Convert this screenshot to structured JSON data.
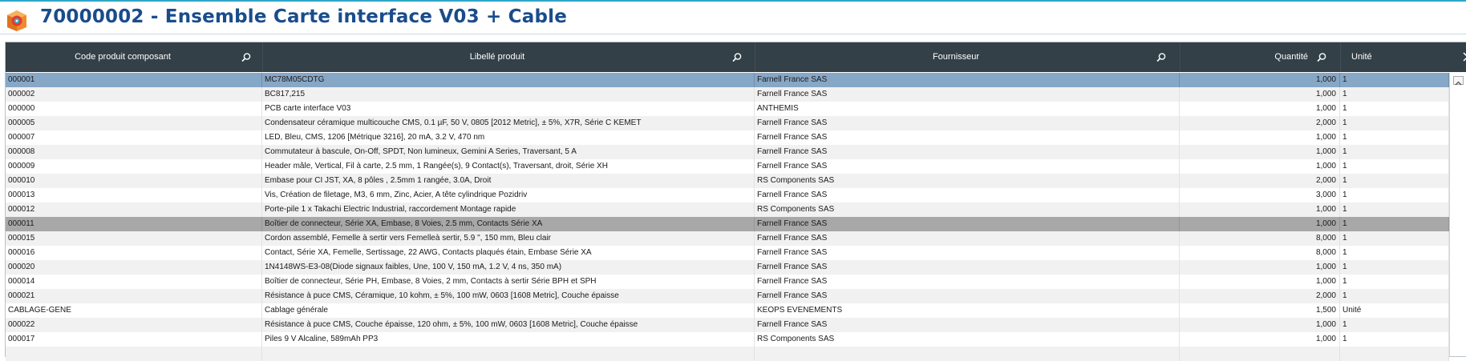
{
  "window": {
    "title": "70000002 - Ensemble Carte interface V03 + Cable",
    "icon": "box-gear-icon",
    "colors": {
      "title": "#1a4c8c",
      "header_bg": "#334048",
      "selected_row": "#87a7c6",
      "highlight_row": "#a8a8a8"
    }
  },
  "table": {
    "columns": [
      {
        "key": "code",
        "label": "Code produit composant"
      },
      {
        "key": "libelle",
        "label": "Libellé produit"
      },
      {
        "key": "fournisseur",
        "label": "Fournisseur"
      },
      {
        "key": "quantite",
        "label": "Quantité"
      },
      {
        "key": "unite",
        "label": "Unité"
      }
    ],
    "rows": [
      {
        "code": "000001",
        "libelle": "MC78M05CDTG",
        "fournisseur": "Farnell France SAS",
        "quantite": "1,000",
        "unite": "1",
        "state": "selected"
      },
      {
        "code": "000002",
        "libelle": "BC817,215",
        "fournisseur": "Farnell France SAS",
        "quantite": "1,000",
        "unite": "1"
      },
      {
        "code": "000000",
        "libelle": "PCB carte interface V03",
        "fournisseur": "ANTHEMIS",
        "quantite": "1,000",
        "unite": "1"
      },
      {
        "code": "000005",
        "libelle": "Condensateur céramique multicouche CMS, 0.1 µF, 50 V, 0805 [2012 Metric], ± 5%, X7R, Série C KEMET",
        "fournisseur": "Farnell France SAS",
        "quantite": "2,000",
        "unite": "1"
      },
      {
        "code": "000007",
        "libelle": "LED, Bleu, CMS, 1206 [Métrique 3216], 20 mA, 3.2 V, 470 nm",
        "fournisseur": "Farnell France SAS",
        "quantite": "1,000",
        "unite": "1"
      },
      {
        "code": "000008",
        "libelle": "Commutateur à bascule, On-Off, SPDT, Non lumineux, Gemini A Series, Traversant, 5 A",
        "fournisseur": "Farnell France SAS",
        "quantite": "1,000",
        "unite": "1"
      },
      {
        "code": "000009",
        "libelle": "Header mâle, Vertical, Fil à carte, 2.5 mm, 1 Rangée(s), 9 Contact(s), Traversant, droit, Série XH",
        "fournisseur": "Farnell France SAS",
        "quantite": "1,000",
        "unite": "1"
      },
      {
        "code": "000010",
        "libelle": "Embase pour CI JST, XA, 8 pôles , 2.5mm 1 rangée, 3.0A, Droit",
        "fournisseur": "RS Components SAS",
        "quantite": "2,000",
        "unite": "1"
      },
      {
        "code": "000013",
        "libelle": "Vis, Création de filetage, M3, 6 mm, Zinc, Acier, A tête cylindrique Pozidriv",
        "fournisseur": "Farnell France SAS",
        "quantite": "3,000",
        "unite": "1"
      },
      {
        "code": "000012",
        "libelle": "Porte-pile 1 x Takachi Electric Industrial, raccordement Montage rapide",
        "fournisseur": "RS Components SAS",
        "quantite": "1,000",
        "unite": "1"
      },
      {
        "code": "000011",
        "libelle": "Boîtier de connecteur, Série XA, Embase, 8 Voies, 2.5 mm, Contacts Série XA",
        "fournisseur": "Farnell France SAS",
        "quantite": "1,000",
        "unite": "1",
        "state": "highlight"
      },
      {
        "code": "000015",
        "libelle": "Cordon assemblé, Femelle à sertir vers Femelleà sertir, 5.9 \", 150 mm, Bleu clair",
        "fournisseur": "Farnell France SAS",
        "quantite": "8,000",
        "unite": "1"
      },
      {
        "code": "000016",
        "libelle": "Contact, Série XA, Femelle, Sertissage, 22 AWG, Contacts plaqués étain, Embase Série XA",
        "fournisseur": "Farnell France SAS",
        "quantite": "8,000",
        "unite": "1"
      },
      {
        "code": "000020",
        "libelle": "1N4148WS-E3-08(Diode signaux faibles, Une, 100 V, 150 mA, 1.2 V, 4 ns, 350 mA)",
        "fournisseur": "Farnell France SAS",
        "quantite": "1,000",
        "unite": "1"
      },
      {
        "code": "000014",
        "libelle": "Boîtier de connecteur, Série PH, Embase, 8 Voies, 2 mm, Contacts à sertir Série BPH et SPH",
        "fournisseur": "Farnell France SAS",
        "quantite": "1,000",
        "unite": "1"
      },
      {
        "code": "000021",
        "libelle": "Résistance à puce CMS, Céramique, 10 kohm, ± 5%, 100 mW, 0603 [1608 Metric], Couche épaisse",
        "fournisseur": "Farnell France SAS",
        "quantite": "2,000",
        "unite": "1"
      },
      {
        "code": "CABLAGE-GENE",
        "libelle": "Cablage générale",
        "fournisseur": "KEOPS EVENEMENTS",
        "quantite": "1,500",
        "unite": "Unité"
      },
      {
        "code": "000022",
        "libelle": "Résistance à puce CMS, Couche épaisse, 120 ohm, ± 5%, 100 mW, 0603 [1608 Metric], Couche épaisse",
        "fournisseur": "Farnell France SAS",
        "quantite": "1,000",
        "unite": "1"
      },
      {
        "code": "000017",
        "libelle": "Piles 9 V Alcaline, 589mAh PP3",
        "fournisseur": "RS Components SAS",
        "quantite": "1,000",
        "unite": "1"
      },
      {
        "code": "",
        "libelle": "",
        "fournisseur": "",
        "quantite": "",
        "unite": ""
      }
    ]
  }
}
